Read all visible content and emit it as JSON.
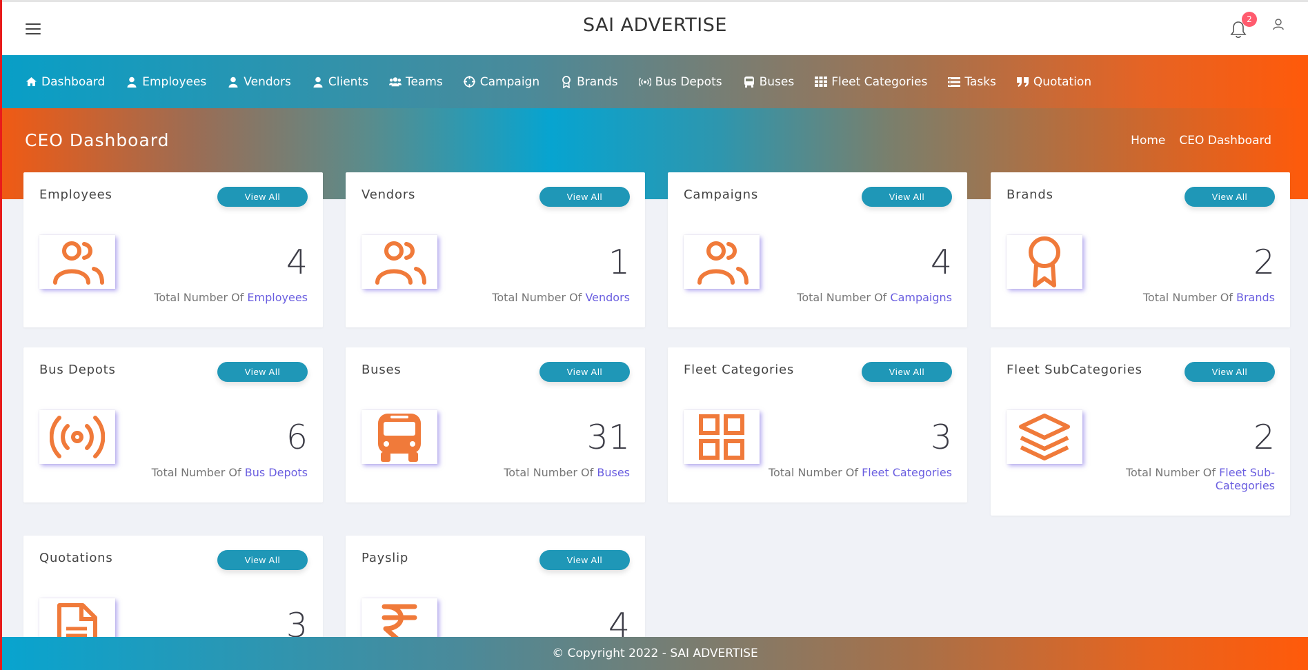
{
  "header": {
    "title": "SAI ADVERTISE",
    "notification_count": "2"
  },
  "nav": {
    "items": [
      {
        "label": "Dashboard",
        "icon": "home-icon"
      },
      {
        "label": "Employees",
        "icon": "user-icon"
      },
      {
        "label": "Vendors",
        "icon": "user-icon"
      },
      {
        "label": "Clients",
        "icon": "user-icon"
      },
      {
        "label": "Teams",
        "icon": "users-icon"
      },
      {
        "label": "Campaign",
        "icon": "target-icon"
      },
      {
        "label": "Brands",
        "icon": "award-icon"
      },
      {
        "label": "Bus Depots",
        "icon": "broadcast-icon"
      },
      {
        "label": "Buses",
        "icon": "bus-icon"
      },
      {
        "label": "Fleet Categories",
        "icon": "grid-icon"
      },
      {
        "label": "Tasks",
        "icon": "tasks-icon"
      },
      {
        "label": "Quotation",
        "icon": "quote-icon"
      }
    ]
  },
  "hero": {
    "title": "CEO Dashboard",
    "breadcrumb": [
      "Home",
      "CEO Dashboard"
    ]
  },
  "cards": [
    {
      "title": "Employees",
      "button": "View All",
      "count": "4",
      "sub_prefix": "Total Number Of ",
      "sub_hl": "Employees",
      "icon": "users-icon"
    },
    {
      "title": "Vendors",
      "button": "View All",
      "count": "1",
      "sub_prefix": "Total Number Of ",
      "sub_hl": "Vendors",
      "icon": "users-icon"
    },
    {
      "title": "Campaigns",
      "button": "View All",
      "count": "4",
      "sub_prefix": "Total Number Of ",
      "sub_hl": "Campaigns",
      "icon": "users-icon"
    },
    {
      "title": "Brands",
      "button": "View All",
      "count": "2",
      "sub_prefix": "Total Number Of ",
      "sub_hl": "Brands",
      "icon": "award-icon"
    },
    {
      "title": "Bus Depots",
      "button": "View All",
      "count": "6",
      "sub_prefix": "Total Number Of ",
      "sub_hl": "Bus Depots",
      "icon": "broadcast-icon"
    },
    {
      "title": "Buses",
      "button": "View All",
      "count": "31",
      "sub_prefix": "Total Number Of ",
      "sub_hl": "Buses",
      "icon": "bus-icon"
    },
    {
      "title": "Fleet Categories",
      "button": "View All",
      "count": "3",
      "sub_prefix": "Total Number Of ",
      "sub_hl": "Fleet Categories",
      "icon": "grid-icon"
    },
    {
      "title": "Fleet SubCategories",
      "button": "View All",
      "count": "2",
      "sub_prefix": "Total Number Of ",
      "sub_hl": "Fleet Sub-",
      "sub_hl2": "Categories",
      "icon": "layers-icon"
    },
    {
      "title": "Quotations",
      "button": "View All",
      "count": "3",
      "sub_prefix": "",
      "sub_hl": "",
      "icon": "document-icon"
    },
    {
      "title": "Payslip",
      "button": "View All",
      "count": "4",
      "sub_prefix": "",
      "sub_hl": "",
      "icon": "rupee-icon"
    }
  ],
  "footer": {
    "text": "© Copyright 2022 - SAI ADVERTISE"
  },
  "colors": {
    "accent": "#1f97b7",
    "icon": "#f07a3a",
    "highlight": "#6a5ee0",
    "orange": "#ff5a0a",
    "cyan": "#08a4cf"
  }
}
